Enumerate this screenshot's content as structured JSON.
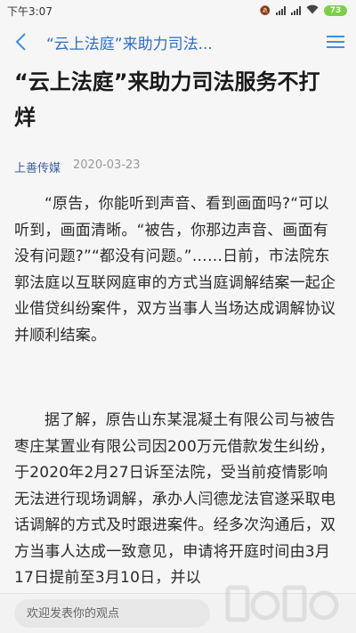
{
  "status_bar": {
    "time": "下午3:07",
    "battery": "73"
  },
  "nav": {
    "title": "“云上法庭”来助力司法..."
  },
  "article": {
    "title": "“云上法庭”来助力司法服务不打烊",
    "author": "上善传媒",
    "date": "2020-03-23",
    "paragraphs": [
      "“原告，你能听到声音、看到画面吗?“可以听到，画面清晰。“被告，你那边声音、画面有没有问题?”“都没有问题。”……日前，市法院东郭法庭以互联网庭审的方式当庭调解结案一起企业借贷纠纷案件，双方当事人当场达成调解协议并顺利结案。",
      "据了解，原告山东某混凝土有限公司与被告枣庄某置业有限公司因200万元借款发生纠纷，于2020年2月27日诉至法院，受当前疫情影响无法进行现场调解，承办人闫德龙法官遂采取电话调解的方式及时跟进案件。经多次沟通后，双方当事人达成一致意见，申请将开庭时间由3月17日提前至3月10日，并以"
    ]
  },
  "comment": {
    "placeholder": "欢迎发表你的观点"
  },
  "colors": {
    "accent": "#3c8fe0",
    "nav_title": "#2f6ec9",
    "author": "#3a5f9a",
    "battery": "#7ad04a"
  },
  "icons": {
    "back": "chevron-left-icon",
    "menu": "hamburger-menu-icon"
  }
}
